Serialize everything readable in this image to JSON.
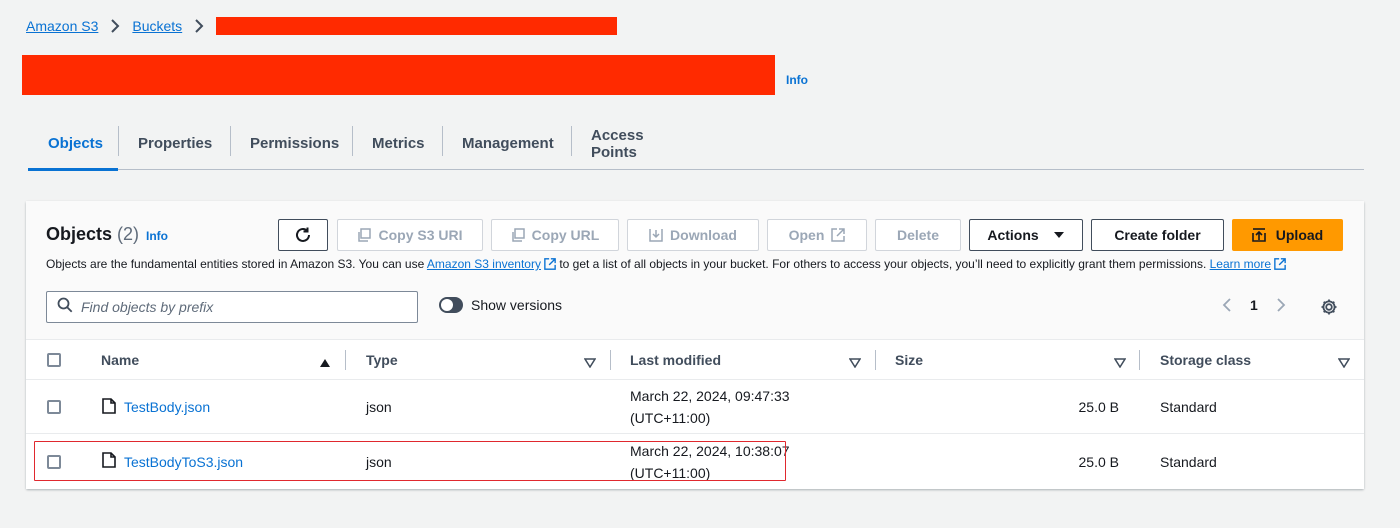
{
  "breadcrumb": {
    "items": [
      "Amazon S3",
      "Buckets"
    ]
  },
  "page": {
    "info_label": "Info"
  },
  "tabs": [
    "Objects",
    "Properties",
    "Permissions",
    "Metrics",
    "Management",
    "Access Points"
  ],
  "objects_panel": {
    "title": "Objects",
    "count": "(2)",
    "info_label": "Info",
    "buttons": {
      "refresh_icon": "refresh-icon",
      "copy_s3_uri": "Copy S3 URI",
      "copy_url": "Copy URL",
      "download": "Download",
      "open": "Open",
      "delete": "Delete",
      "actions": "Actions",
      "create_folder": "Create folder",
      "upload": "Upload"
    },
    "description": {
      "part1": "Objects are the fundamental entities stored in Amazon S3. You can use ",
      "inventory_link": "Amazon S3 inventory",
      "part2": " to get a list of all objects in your bucket. For others to access your objects, you’ll need to explicitly grant them permissions. ",
      "learn_more_link": "Learn more"
    },
    "search": {
      "placeholder": "Find objects by prefix",
      "value": ""
    },
    "show_versions_label": "Show versions",
    "pagination": {
      "current_page": "1"
    }
  },
  "table": {
    "columns": [
      "Name",
      "Type",
      "Last modified",
      "Size",
      "Storage class"
    ],
    "rows": [
      {
        "name": "TestBody.json",
        "type": "json",
        "modified_line1": "March 22, 2024, 09:47:33",
        "modified_line2": "(UTC+11:00)",
        "size": "25.0 B",
        "storage_class": "Standard"
      },
      {
        "name": "TestBodyToS3.json",
        "type": "json",
        "modified_line1": "March 22, 2024, 10:38:07",
        "modified_line2": "(UTC+11:00)",
        "size": "25.0 B",
        "storage_class": "Standard"
      }
    ]
  },
  "colors": {
    "link": "#0972d3",
    "upload_button": "#ff9900",
    "redaction": "#ff2a00",
    "highlight_border": "#e0282e"
  }
}
